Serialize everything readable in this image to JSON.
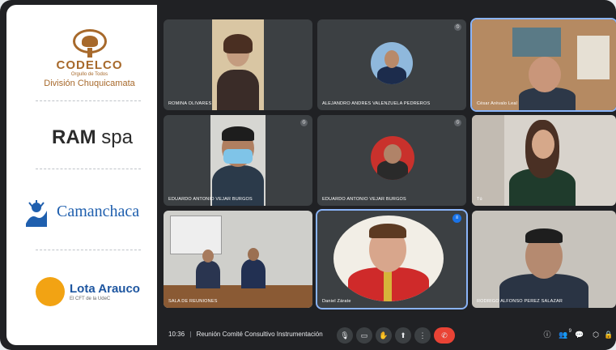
{
  "sponsors": {
    "codelco": {
      "name": "CODELCO",
      "tagline": "Orgullo de Todos",
      "division": "División Chuquicamata"
    },
    "ram": {
      "bold": "RAM",
      "rest": " spa"
    },
    "camanchaca": {
      "name": "Camanchaca"
    },
    "lota": {
      "name": "Lota Arauco",
      "subtitle": "El CFT de la UdeC"
    }
  },
  "participants": [
    {
      "name": "ROMINA OLIVARES"
    },
    {
      "name": "ALEJANDRO ANDRES VALENZUELA PEDREROS"
    },
    {
      "name": "César Arévalo Leal"
    },
    {
      "name": "EDUARDO ANTONIO VEJAR BURGOS"
    },
    {
      "name": "EDUARDO ANTONIO VEJAR BURGOS"
    },
    {
      "name": "Tú"
    },
    {
      "name": "SALA DE REUNIONES"
    },
    {
      "name": "Daniel Zárate"
    },
    {
      "name": "RODRIGO ALFONSO PEREZ SALAZAR"
    }
  ],
  "meeting": {
    "time": "10:36",
    "separator": "|",
    "title": "Reunión Comité Consultivo Instrumentación"
  },
  "controls": {
    "mic": "🎙",
    "camera": "▭",
    "hand": "✋",
    "present": "⬆",
    "more": "⋮",
    "end": "✆"
  },
  "right_controls": {
    "info": "ⓘ",
    "people": "👥",
    "people_count": "9",
    "chat": "💬",
    "activities": "⬡",
    "lock": "🔒"
  },
  "colors": {
    "codelco": "#a7692b",
    "camanchaca": "#1f5fae",
    "lota": "#1e56a0",
    "meet_bg": "#202124",
    "tile_bg": "#3c4043",
    "end_call": "#ea4335"
  }
}
